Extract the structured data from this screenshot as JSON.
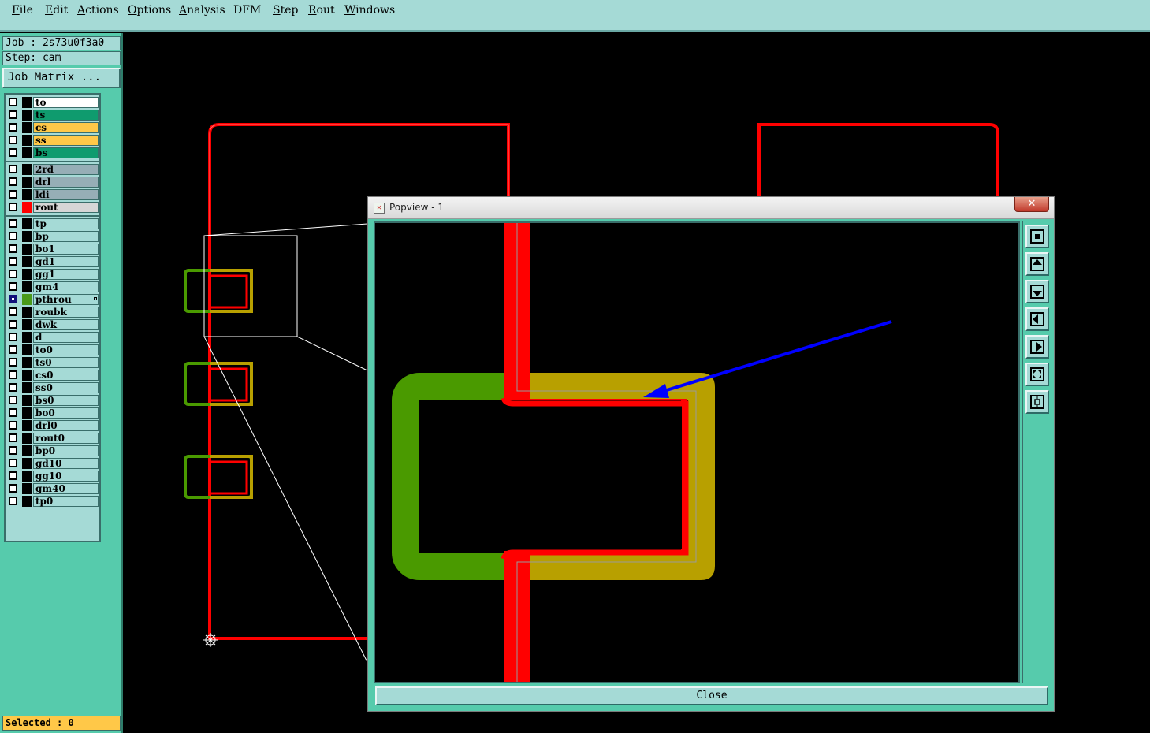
{
  "menu": {
    "items": [
      {
        "label": "File",
        "key": "F"
      },
      {
        "label": "Edit",
        "key": "E"
      },
      {
        "label": "Actions",
        "key": "A"
      },
      {
        "label": "Options",
        "key": "O"
      },
      {
        "label": "Analysis",
        "key": "A"
      },
      {
        "label": "DFM",
        "key": ""
      },
      {
        "label": "Step",
        "key": "S"
      },
      {
        "label": "Rout",
        "key": "R"
      },
      {
        "label": "Windows",
        "key": "W"
      }
    ]
  },
  "panel": {
    "job": "Job : 2s73u0f3a0",
    "step": "Step: cam",
    "job_matrix_label": "Job Matrix ...",
    "selected": "Selected : 0"
  },
  "layers": [
    {
      "name": "to",
      "bg": "#ffffff",
      "swatch": "#000000",
      "checked": false
    },
    {
      "name": "ts",
      "bg": "#0f9b6e",
      "swatch": "#000000",
      "checked": false
    },
    {
      "name": "cs",
      "bg": "#ffc848",
      "swatch": "#000000",
      "checked": false
    },
    {
      "name": "ss",
      "bg": "#ffc848",
      "swatch": "#000000",
      "checked": false
    },
    {
      "name": "bs",
      "bg": "#0f9b6e",
      "swatch": "#000000",
      "checked": false
    },
    {
      "name": "2rd",
      "bg": "#96aeb6",
      "swatch": "#000000",
      "checked": false
    },
    {
      "name": "drl",
      "bg": "#96aeb6",
      "swatch": "#000000",
      "checked": false
    },
    {
      "name": "ldi",
      "bg": "#96aeb6",
      "swatch": "#000000",
      "checked": false
    },
    {
      "name": "rout",
      "bg": "#d6d6d6",
      "swatch": "#ff0000",
      "checked": false
    },
    {
      "name": "tp",
      "bg": "#a5dad6",
      "swatch": "#000000",
      "checked": false
    },
    {
      "name": "bp",
      "bg": "#a5dad6",
      "swatch": "#000000",
      "checked": false
    },
    {
      "name": "bo1",
      "bg": "#a5dad6",
      "swatch": "#000000",
      "checked": false
    },
    {
      "name": "gd1",
      "bg": "#a5dad6",
      "swatch": "#000000",
      "checked": false
    },
    {
      "name": "gg1",
      "bg": "#a5dad6",
      "swatch": "#000000",
      "checked": false
    },
    {
      "name": "gm4",
      "bg": "#a5dad6",
      "swatch": "#000000",
      "checked": false
    },
    {
      "name": "pthrou",
      "bg": "#a5dad6",
      "swatch": "#4a9a1a",
      "checked": true
    },
    {
      "name": "roubk",
      "bg": "#a5dad6",
      "swatch": "#000000",
      "checked": false
    },
    {
      "name": "dwk",
      "bg": "#a5dad6",
      "swatch": "#000000",
      "checked": false
    },
    {
      "name": "d",
      "bg": "#a5dad6",
      "swatch": "#000000",
      "checked": false
    },
    {
      "name": "to0",
      "bg": "#a5dad6",
      "swatch": "#000000",
      "checked": false
    },
    {
      "name": "ts0",
      "bg": "#a5dad6",
      "swatch": "#000000",
      "checked": false
    },
    {
      "name": "cs0",
      "bg": "#a5dad6",
      "swatch": "#000000",
      "checked": false
    },
    {
      "name": "ss0",
      "bg": "#a5dad6",
      "swatch": "#000000",
      "checked": false
    },
    {
      "name": "bs0",
      "bg": "#a5dad6",
      "swatch": "#000000",
      "checked": false
    },
    {
      "name": "bo0",
      "bg": "#a5dad6",
      "swatch": "#000000",
      "checked": false
    },
    {
      "name": "drl0",
      "bg": "#a5dad6",
      "swatch": "#000000",
      "checked": false
    },
    {
      "name": "rout0",
      "bg": "#a5dad6",
      "swatch": "#000000",
      "checked": false
    },
    {
      "name": "bp0",
      "bg": "#a5dad6",
      "swatch": "#000000",
      "checked": false
    },
    {
      "name": "gd10",
      "bg": "#a5dad6",
      "swatch": "#000000",
      "checked": false
    },
    {
      "name": "gg10",
      "bg": "#a5dad6",
      "swatch": "#000000",
      "checked": false
    },
    {
      "name": "gm40",
      "bg": "#a5dad6",
      "swatch": "#000000",
      "checked": false
    },
    {
      "name": "tp0",
      "bg": "#a5dad6",
      "swatch": "#000000",
      "checked": false
    }
  ],
  "popview": {
    "title": "Popview - 1",
    "close_x": "✕",
    "close_label": "Close",
    "tools": [
      "zoom-window-icon",
      "pan-up-icon",
      "pan-down-icon",
      "pan-left-icon",
      "pan-right-icon",
      "zoom-fit-icon",
      "zoom-center-icon"
    ]
  },
  "colors": {
    "rout": "#ff0000",
    "pthrou": "#4a9a00",
    "overlap": "#b8a000",
    "arrow": "#0000ff",
    "panel": "#56cbac",
    "panel_light": "#a5dad6"
  }
}
